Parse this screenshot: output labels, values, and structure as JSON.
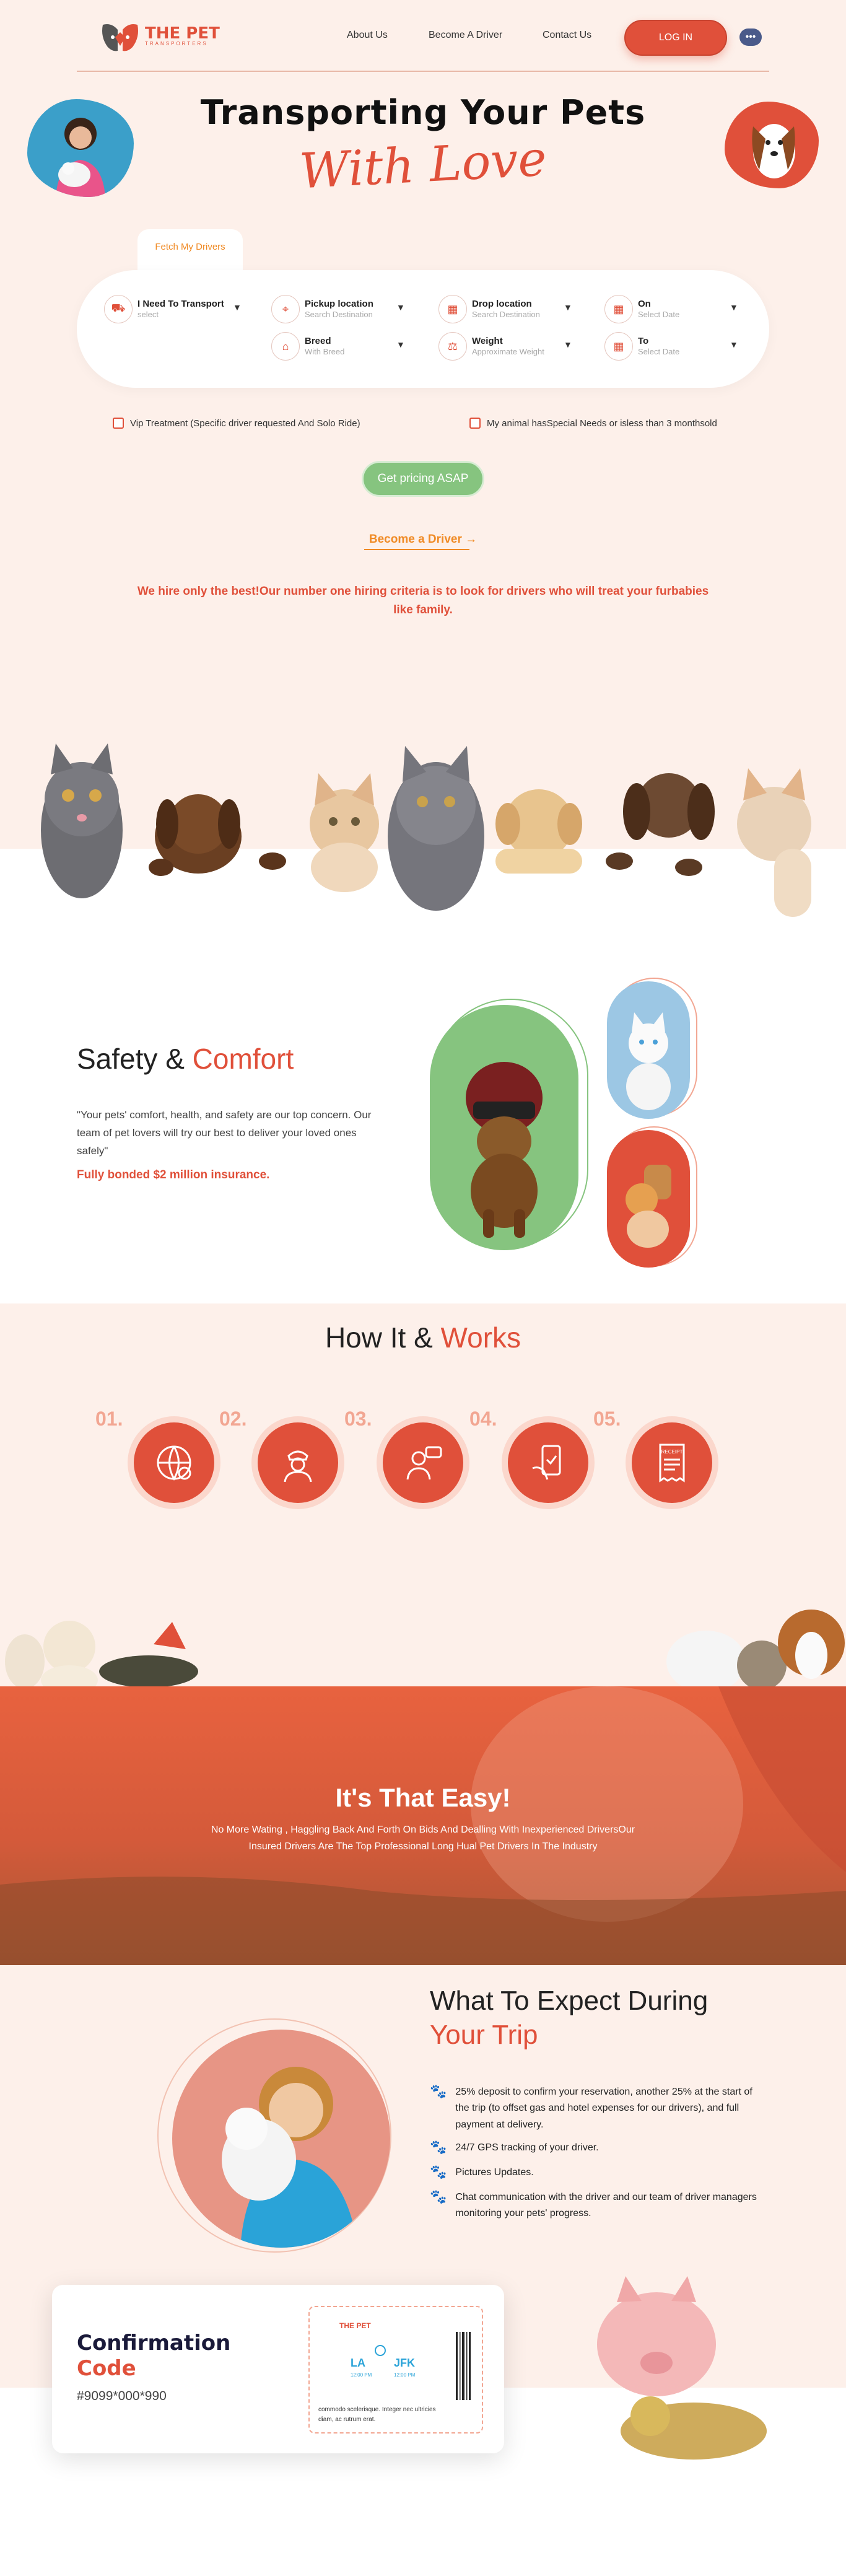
{
  "header": {
    "logo_main": "THE PET",
    "logo_sub": "TRANSPORTERS",
    "nav": [
      "About Us",
      "Become A Driver",
      "Contact Us"
    ],
    "login_label": "LOG IN"
  },
  "hero": {
    "title": "Transporting Your Pets",
    "script": "With Love",
    "tab_label": "Fetch My Drivers",
    "fields": [
      {
        "label": "I Need To Transport",
        "sub": "select"
      },
      {
        "label": "Pickup location",
        "sub": "Search Destination"
      },
      {
        "label": "Drop location",
        "sub": "Search Destination"
      },
      {
        "label": "On",
        "sub": "Select Date"
      },
      {
        "label": "Breed",
        "sub": "With Breed"
      },
      {
        "label": "Weight",
        "sub": "Approximate Weight"
      },
      {
        "label": "To",
        "sub": "Select Date"
      }
    ],
    "checkboxes": [
      "Vip Treatment (Specific driver requested And Solo Ride)",
      "My animal hasSpecial Needs or isless than 3 monthsold"
    ],
    "price_button": "Get pricing ASAP",
    "driver_link": "Become a Driver",
    "driver_arrow": "→",
    "hire_text": "We hire only the best!Our number one hiring criteria is to look for drivers who will treat your furbabies like family."
  },
  "safety": {
    "title_a": "Safety & ",
    "title_b": "Comfort",
    "text": "\"Your pets' comfort, health, and safety are our top concern. Our team of pet lovers will try our best to deliver your loved ones safely\"",
    "insurance": "Fully bonded $2 million insurance."
  },
  "how": {
    "title_a": "How It & ",
    "title_b": "Works",
    "steps": [
      "01.",
      "02.",
      "03.",
      "04.",
      "05."
    ],
    "receipt_label": "RECEIPT"
  },
  "easy": {
    "title": "It's That Easy!",
    "text": "No More Wating , Haggling Back And Forth On Bids And Dealling With Inexperienced DriversOur Insured Drivers Are The Top Professional Long Hual Pet Drivers In The Industry"
  },
  "expect": {
    "title_a": "What To Expect During",
    "title_b": "Your Trip",
    "bullets": [
      "25% deposit to confirm your reservation, another 25% at the start of the trip (to offset gas and hotel expenses for our drivers), and full payment at delivery.",
      "24/7 GPS tracking of your driver.",
      "Pictures Updates.",
      "Chat communication with the driver and our team of driver managers monitoring your pets' progress."
    ]
  },
  "confirmation": {
    "title_a": "Confirmation",
    "title_b": "Code",
    "code": "#9099*000*990",
    "ticket_from": "LA",
    "ticket_to": "JFK",
    "ticket_time_from": "12:00 PM",
    "ticket_time_to": "12:00 PM",
    "ticket_note": "commodo scelerisque. Integer nec ultricies diam, ac rutrum erat."
  },
  "colors": {
    "accent": "#e0503a",
    "orange": "#f08a24",
    "green": "#86c47f",
    "background": "#fdf0ea"
  }
}
